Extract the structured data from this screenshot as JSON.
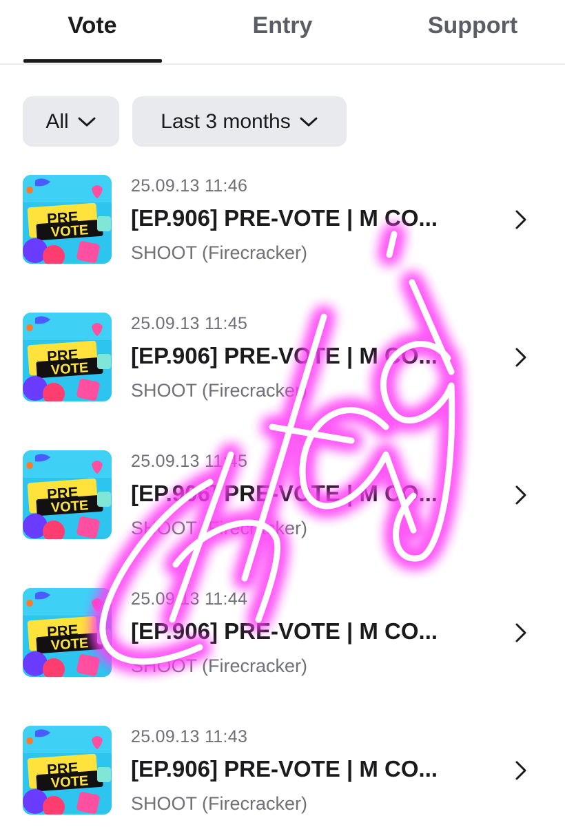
{
  "tabs": [
    {
      "label": "Vote",
      "active": true
    },
    {
      "label": "Entry",
      "active": false
    },
    {
      "label": "Support",
      "active": false
    }
  ],
  "filters": {
    "category": "All",
    "period": "Last 3 months"
  },
  "items": [
    {
      "date": "25.09.13 11:46",
      "title": "[EP.906] PRE-VOTE | M CO...",
      "subtitle": "SHOOT (Firecracker)",
      "thumb_line1": "PRE",
      "thumb_line2": "VOTE"
    },
    {
      "date": "25.09.13 11:45",
      "title": "[EP.906] PRE-VOTE | M CO...",
      "subtitle": "SHOOT (Firecracker)",
      "thumb_line1": "PRE",
      "thumb_line2": "VOTE"
    },
    {
      "date": "25.09.13 11:45",
      "title": "[EP.906] PRE-VOTE | M CO...",
      "subtitle": "SHOOT (Firecracker)",
      "thumb_line1": "PRE",
      "thumb_line2": "VOTE"
    },
    {
      "date": "25.09.13 11:44",
      "title": "[EP.906] PRE-VOTE | M CO...",
      "subtitle": "SHOOT (Firecracker)",
      "thumb_line1": "PRE",
      "thumb_line2": "VOTE"
    },
    {
      "date": "25.09.13 11:43",
      "title": "[EP.906] PRE-VOTE | M CO...",
      "subtitle": "SHOOT (Firecracker)",
      "thumb_line1": "PRE",
      "thumb_line2": "VOTE"
    }
  ],
  "overlay": {
    "handwriting": "Ch+ag",
    "color": "#ff3df5"
  },
  "colors": {
    "accent": "#1a1a1a",
    "muted_text": "#6e7075",
    "filter_bg": "#e9eaed",
    "thumb_bg": "#2ec4f0"
  },
  "icons": {
    "filter_chevron": "chevron-down-icon",
    "row_chevron": "chevron-right-icon"
  }
}
